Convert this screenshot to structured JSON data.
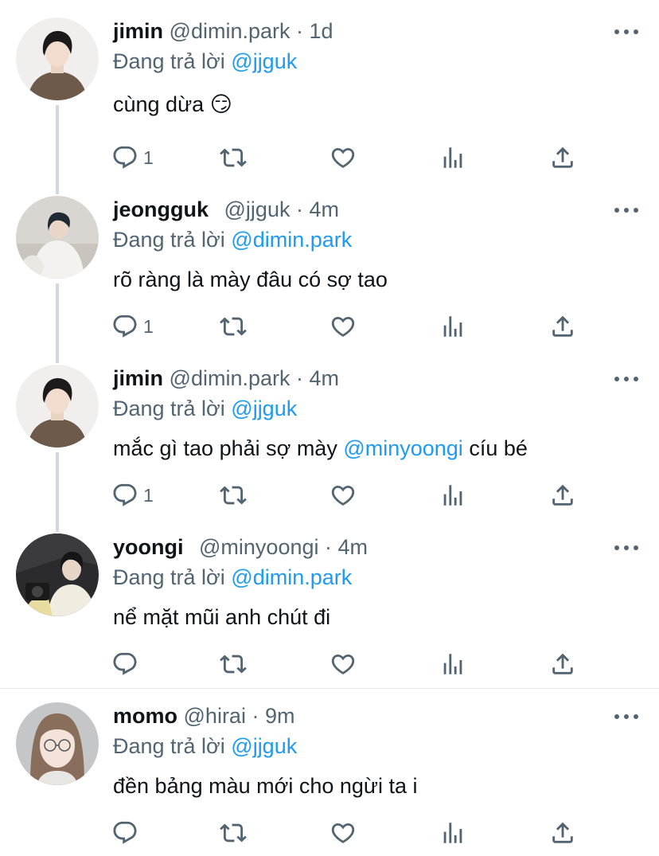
{
  "reply_prefix": "Đang trả lời",
  "colors": {
    "link": "#1d9bf0",
    "muted": "#536471",
    "text": "#0f1419"
  },
  "tweets": [
    {
      "name": "jimin",
      "handle": "@dimin.park",
      "time": "1d",
      "reply_to": "@jjguk",
      "text": "cùng dừa",
      "emoji": "😏",
      "reply_count": "1"
    },
    {
      "name": "jeongguk",
      "handle": "@jjguk",
      "time": "4m",
      "reply_to": "@dimin.park",
      "text": "rõ ràng là mày đâu có sợ tao",
      "reply_count": "1"
    },
    {
      "name": "jimin",
      "handle": "@dimin.park",
      "time": "4m",
      "reply_to": "@jjguk",
      "text_before": "mắc gì tao phải sợ mày ",
      "text_mention": "@minyoongi",
      "text_after": " cíu bé",
      "reply_count": "1"
    },
    {
      "name": "yoongi",
      "handle": "@minyoongi",
      "time": "4m",
      "reply_to": "@dimin.park",
      "text": "nể mặt mũi anh chút đi",
      "reply_count": ""
    },
    {
      "name": "momo",
      "handle": "@hirai",
      "time": "9m",
      "reply_to": "@jjguk",
      "text": "đền bảng màu mới cho ngừi ta i",
      "reply_count": ""
    }
  ],
  "icons": [
    "reply-icon",
    "retweet-icon",
    "like-icon",
    "analytics-icon",
    "share-icon",
    "more-icon"
  ]
}
